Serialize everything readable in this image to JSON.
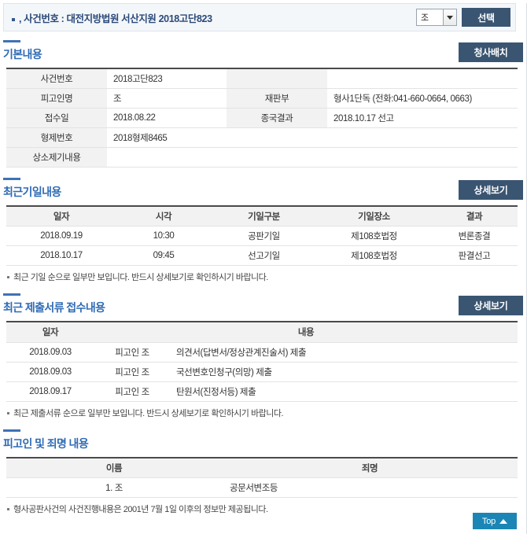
{
  "header": {
    "case_label": ", 사건번호 : 대전지방법원 서산지원 2018고단823",
    "party_select_value": "조",
    "select_button": "선택"
  },
  "basic": {
    "title": "기본내용",
    "building_button": "청사배치",
    "rows": [
      {
        "label": "사건번호",
        "value": "2018고단823",
        "label2": "",
        "value2": ""
      },
      {
        "label": "피고인명",
        "value": "조",
        "label2": "재판부",
        "value2": "형사1단독 (전화:041-660-0664, 0663)"
      },
      {
        "label": "접수일",
        "value": "2018.08.22",
        "label2": "종국결과",
        "value2": "2018.10.17 선고"
      },
      {
        "label": "형제번호",
        "value": "2018형제8465",
        "label2": null,
        "value2": null
      },
      {
        "label": "상소제기내용",
        "value": "",
        "label2": null,
        "value2": null
      }
    ]
  },
  "hearings": {
    "title": "최근기일내용",
    "detail_button": "상세보기",
    "columns": [
      "일자",
      "시각",
      "기일구분",
      "기일장소",
      "결과"
    ],
    "rows": [
      [
        "2018.09.19",
        "10:30",
        "공판기일",
        "제108호법정",
        "변론종결"
      ],
      [
        "2018.10.17",
        "09:45",
        "선고기일",
        "제108호법정",
        "판결선고"
      ]
    ],
    "note": "최근 기일 순으로 일부만 보입니다. 반드시 상세보기로 확인하시기 바랍니다."
  },
  "documents": {
    "title": "최근 제출서류 접수내용",
    "detail_button": "상세보기",
    "columns": [
      "일자",
      "내용"
    ],
    "rows": [
      [
        "2018.09.03",
        "피고인 조",
        "의견서(답변서/정상관계진술서) 제출"
      ],
      [
        "2018.09.03",
        "피고인 조",
        "국선변호인청구(의망) 제출"
      ],
      [
        "2018.09.17",
        "피고인 조",
        "탄원서(진정서등) 제출"
      ]
    ],
    "note": "최근 제출서류 순으로 일부만 보입니다. 반드시 상세보기로 확인하시기 바랍니다."
  },
  "defendants": {
    "title": "피고인 및 죄명 내용",
    "columns": [
      "이름",
      "죄명"
    ],
    "rows": [
      [
        "1. 조",
        "공문서변조등"
      ]
    ],
    "note": "형사공판사건의 사건진행내용은 2001년 7월 1일 이후의 정보만 제공됩니다."
  },
  "footer": {
    "top_button": "Top"
  }
}
